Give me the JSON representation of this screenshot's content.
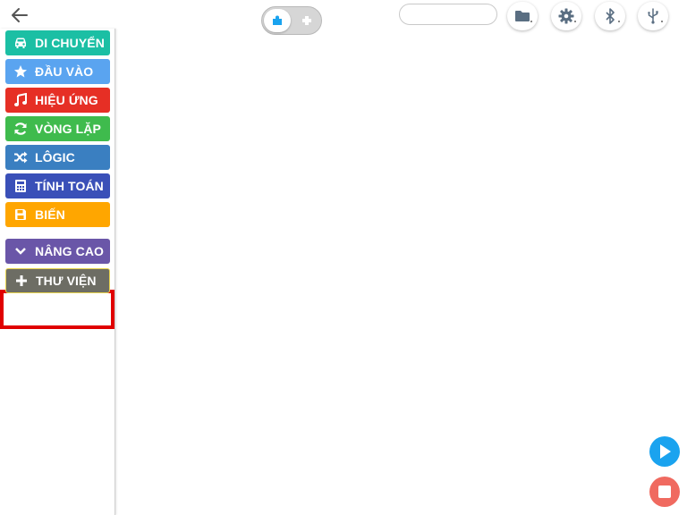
{
  "header": {
    "back_icon": "arrow-left-icon",
    "mode_toggle": {
      "active_icon": "puzzle-block-icon",
      "inactive_icon": "plus-block-icon"
    },
    "project_name": {
      "value": "",
      "placeholder": ""
    },
    "buttons": [
      {
        "name": "folder-button",
        "icon": "folder-icon"
      },
      {
        "name": "settings-button",
        "icon": "gear-icon"
      },
      {
        "name": "bluetooth-button",
        "icon": "bluetooth-icon"
      },
      {
        "name": "usb-button",
        "icon": "usb-icon"
      }
    ]
  },
  "sidebar": {
    "categories": [
      {
        "label": "DI CHUYỂN",
        "icon": "car-icon",
        "color": "#1bbfa4"
      },
      {
        "label": "ĐẦU VÀO",
        "icon": "star-icon",
        "color": "#5aa4f0"
      },
      {
        "label": "HIỆU ỨNG",
        "icon": "music-note-icon",
        "color": "#e62f25"
      },
      {
        "label": "VÒNG LẶP",
        "icon": "refresh-icon",
        "color": "#3fbb4d"
      },
      {
        "label": "LÔGIC",
        "icon": "shuffle-icon",
        "color": "#3a7fc1"
      },
      {
        "label": "TÍNH TOÁN",
        "icon": "calculator-icon",
        "color": "#3a50b8"
      },
      {
        "label": "BIẾN",
        "icon": "floppy-icon",
        "color": "#ffa600"
      },
      {
        "label": "NÂNG CAO",
        "icon": "chevron-down-icon",
        "color": "#6a56a8"
      },
      {
        "label": "THƯ VIỆN",
        "icon": "plus-icon",
        "color": "#6d6d64"
      }
    ],
    "highlight_color": "#e00000"
  },
  "controls": {
    "run_icon": "play-icon",
    "run_color": "#1aa3ef",
    "stop_icon": "stop-icon",
    "stop_color": "#f06a60"
  }
}
